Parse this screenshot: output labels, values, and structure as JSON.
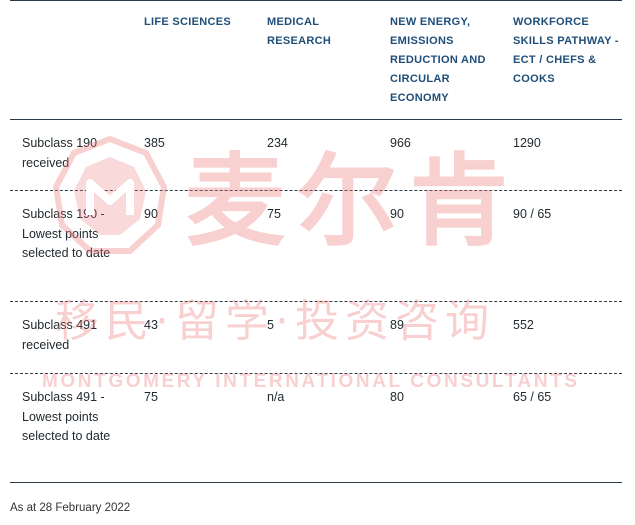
{
  "header": {
    "columns": [
      "LIFE SCIENCES",
      "MEDICAL RESEARCH",
      "NEW ENERGY, EMISSIONS REDUCTION AND CIRCULAR ECONOMY",
      "WORKFORCE SKILLS PATHWAY - ECT / CHEFS & COOKS"
    ]
  },
  "rows": [
    {
      "label": "Subclass 190 received",
      "values": [
        "385",
        "234",
        "966",
        "1290"
      ]
    },
    {
      "label": "Subclass 190 - Lowest points selected to date",
      "values": [
        "90",
        "75",
        "90",
        "90 / 65"
      ]
    },
    {
      "label": "Subclass 491 received",
      "values": [
        "43",
        "5",
        "89",
        "552"
      ]
    },
    {
      "label": "Subclass 491 - Lowest points selected to date",
      "values": [
        "75",
        "n/a",
        "80",
        "65 / 65"
      ]
    }
  ],
  "footnote": "As at 28 February 2022",
  "watermark": {
    "big_text": "麦尔肯",
    "sub_text": "移民·留学·投资咨询",
    "english_text": "MONTGOMERY INTERNATIONAL CONSULTANTS"
  }
}
